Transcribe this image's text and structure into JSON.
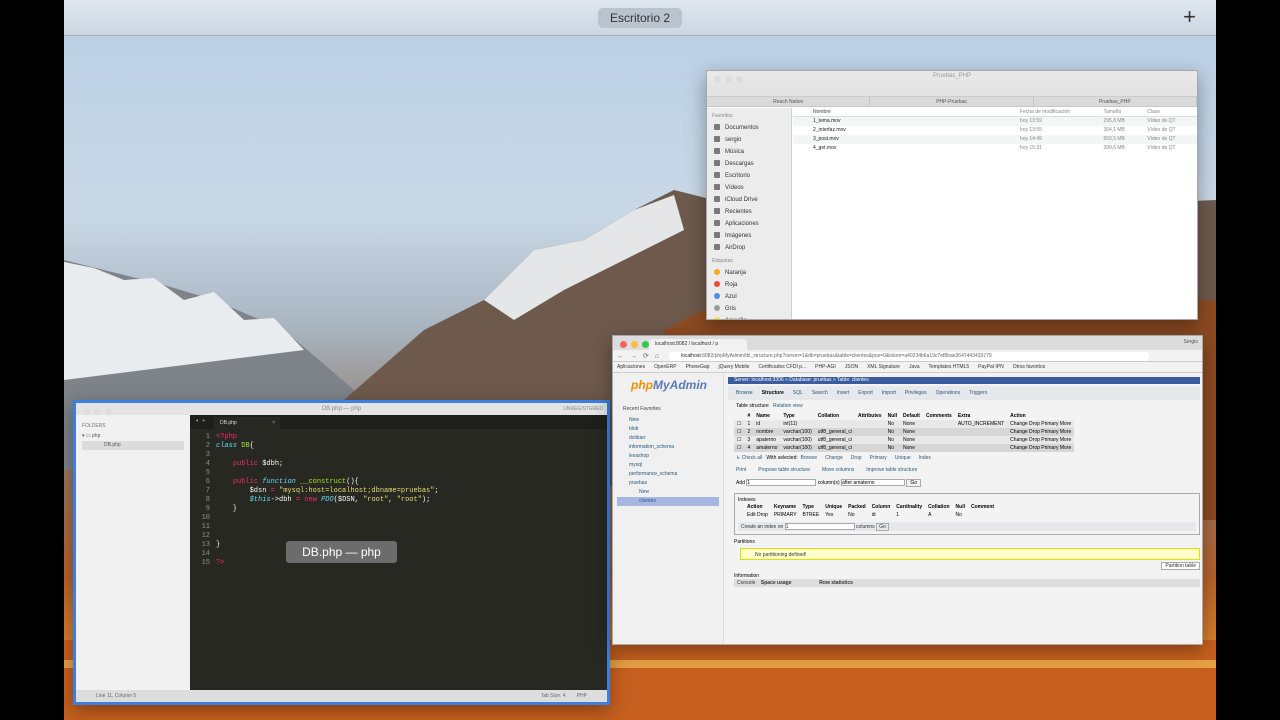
{
  "desktop": {
    "space_label": "Escritorio 2",
    "add_label": "+"
  },
  "finder": {
    "title": "Pruebas_PHP",
    "tabs": [
      "Reach Native",
      "PHP-Pruebas",
      "Pruebas_PHP"
    ],
    "sections": {
      "favorites": "Favoritos",
      "tags": "Etiquetas"
    },
    "sidebar": [
      "Documentos",
      "sergio",
      "Música",
      "Descargas",
      "Escritorio",
      "Vídeos",
      "iCloud Drive",
      "Recientes",
      "Aplicaciones",
      "Imágenes",
      "AirDrop"
    ],
    "tags": [
      "Naranja",
      "Roja",
      "Azul",
      "Gris",
      "Amarilla"
    ],
    "columns": [
      "Nombre",
      "Fecha de modificación",
      "Tamaño",
      "Clase"
    ],
    "files": [
      {
        "name": "1_tema.mov",
        "date": "hoy 13:59",
        "size": "295,8 MB",
        "kind": "Vídeo de QT"
      },
      {
        "name": "2_interfaz.mov",
        "date": "hoy 13:55",
        "size": "364,1 MB",
        "kind": "Vídeo de QT"
      },
      {
        "name": "3_post.mov",
        "date": "hoy 14:49",
        "size": "550,5 MB",
        "kind": "Vídeo de QT"
      },
      {
        "name": "4_get.mov",
        "date": "hoy 15:31",
        "size": "399,6 MB",
        "kind": "Vídeo de QT"
      }
    ]
  },
  "sublime": {
    "title": "DB.php — php",
    "registered": "UNREGISTERED",
    "sidebar": {
      "folders": "FOLDERS",
      "folder": "php",
      "file": "DB.php"
    },
    "tab": "DB.php",
    "status": {
      "left": "Line 11, Column 5",
      "tab": "Tab Size: 4",
      "syntax": "PHP"
    },
    "toast": "DB.php — php"
  },
  "chrome": {
    "tab_title": "localhost:8082 / localhost / p",
    "user": "Sergio",
    "url_host": "localhost",
    "url_rest": ":8082/phpMyAdmin/tbl_structure.php?server=1&db=pruebas&table=clientes&pos=0&token=a40234b6a19c7ef8bae3647443433779",
    "bookmarks": [
      "Aplicaciones",
      "OpenERP",
      "PhoneGap",
      "jQuery Mobile",
      "Certificados CFDI p...",
      "PHP-AGI",
      "JSON",
      "XML Signature",
      "Java",
      "Templates HTML5",
      "PayPal IPN",
      "Otros favoritos"
    ]
  },
  "pma": {
    "logo_a": "php",
    "logo_b": "MyAdmin",
    "side_tabs": "Recent   Favorites",
    "dbs": [
      "New",
      "blob",
      "dolibarr",
      "information_schema",
      "lexashop",
      "mysql",
      "performance_schema",
      "pruebas"
    ],
    "sub_items": [
      "New",
      "clientes"
    ],
    "breadcrumb": "Server: localhost:3306 » Database: pruebas » Table: clientes",
    "menu": [
      "Browse",
      "Structure",
      "SQL",
      "Search",
      "Insert",
      "Export",
      "Import",
      "Privileges",
      "Operations",
      "Triggers"
    ],
    "submenu": [
      "Table structure",
      "Relation view"
    ],
    "columns": [
      "#",
      "Name",
      "Type",
      "Collation",
      "Attributes",
      "Null",
      "Default",
      "Comments",
      "Extra",
      "Action"
    ],
    "rows": [
      {
        "n": "1",
        "name": "id",
        "type": "int(11)",
        "coll": "",
        "nul": "No",
        "def": "None",
        "extra": "AUTO_INCREMENT"
      },
      {
        "n": "2",
        "name": "nombre",
        "type": "varchar(100)",
        "coll": "utf8_general_ci",
        "nul": "No",
        "def": "None",
        "extra": ""
      },
      {
        "n": "3",
        "name": "apaterno",
        "type": "varchar(100)",
        "coll": "utf8_general_ci",
        "nul": "No",
        "def": "None",
        "extra": ""
      },
      {
        "n": "4",
        "name": "amaterno",
        "type": "varchar(100)",
        "coll": "utf8_general_ci",
        "nul": "No",
        "def": "None",
        "extra": ""
      }
    ],
    "row_actions": "Change  Drop  Primary  More",
    "check_all": "Check all",
    "with_selected": "With selected:",
    "sel_actions": [
      "Browse",
      "Change",
      "Drop",
      "Primary",
      "Unique",
      "Index"
    ],
    "bottom_links": [
      "Print",
      "Propose table structure",
      "Move columns",
      "Improve table structure"
    ],
    "add": {
      "label": "Add",
      "value": "1",
      "col": "column(s)",
      "after": "after amaterno",
      "go": "Go"
    },
    "indexes": {
      "legend": "Indexes",
      "cols": [
        "Action",
        "Keyname",
        "Type",
        "Unique",
        "Packed",
        "Column",
        "Cardinality",
        "Collation",
        "Null",
        "Comment"
      ],
      "row": [
        "Edit  Drop",
        "PRIMARY",
        "BTREE",
        "Yes",
        "No",
        "id",
        "1",
        "A",
        "No",
        ""
      ],
      "create": "Create an index on",
      "create_val": "1",
      "create_cols": "columns",
      "go": "Go"
    },
    "partitions": {
      "legend": "Partitions",
      "msg": "No partitioning defined!",
      "btn": "Partition table"
    },
    "info": {
      "legend": "Information",
      "console": "Console",
      "space": "Space usage",
      "rowstats": "Row statistics"
    }
  }
}
